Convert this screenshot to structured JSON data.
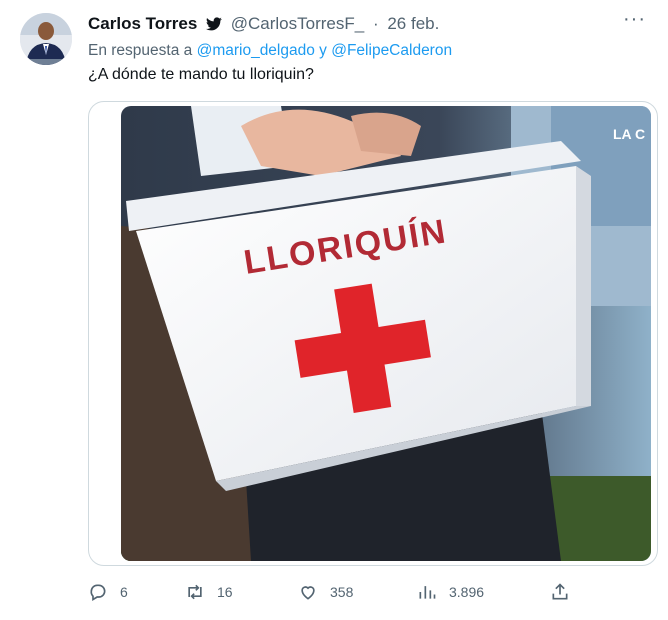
{
  "tweet": {
    "author_name": "Carlos Torres",
    "handle": "@CarlosTorresF_",
    "separator": "·",
    "date": "26 feb.",
    "more_label": "···",
    "reply_prefix": "En respuesta a",
    "reply_mention_1": "@mario_delgado",
    "reply_conjunction": "y",
    "reply_mention_2": "@FelipeCalderon",
    "text": "¿A dónde te mando tu lloriquin?",
    "image": {
      "box_label": "LLORIQUÍN",
      "corner_text": "LA C",
      "icon": "first-aid-box"
    }
  },
  "actions": {
    "replies": "6",
    "retweets": "16",
    "likes": "358",
    "views": "3.896"
  },
  "colors": {
    "text_primary": "#0f1419",
    "text_secondary": "#536471",
    "link": "#1d9bf0",
    "cross": "#e0242a",
    "label": "#b22a35",
    "border": "#cfd9de"
  }
}
